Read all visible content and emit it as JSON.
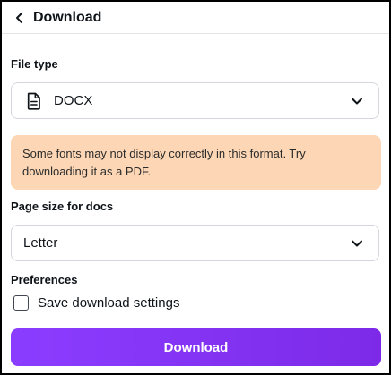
{
  "header": {
    "title": "Download",
    "back_icon": "chevron-left-icon"
  },
  "file_type": {
    "label": "File type",
    "selected": "DOCX",
    "icon": "document-icon",
    "dropdown_icon": "chevron-down-icon"
  },
  "warning": {
    "text": "Some fonts may not display correctly in this format. Try downloading it as a PDF.",
    "color": "#fdd7b5"
  },
  "page_size": {
    "label": "Page size for docs",
    "selected": "Letter",
    "dropdown_icon": "chevron-down-icon"
  },
  "preferences": {
    "label": "Preferences",
    "save_settings_label": "Save download settings",
    "save_settings_checked": false
  },
  "download_button": {
    "label": "Download",
    "color": "#8b3dff"
  }
}
